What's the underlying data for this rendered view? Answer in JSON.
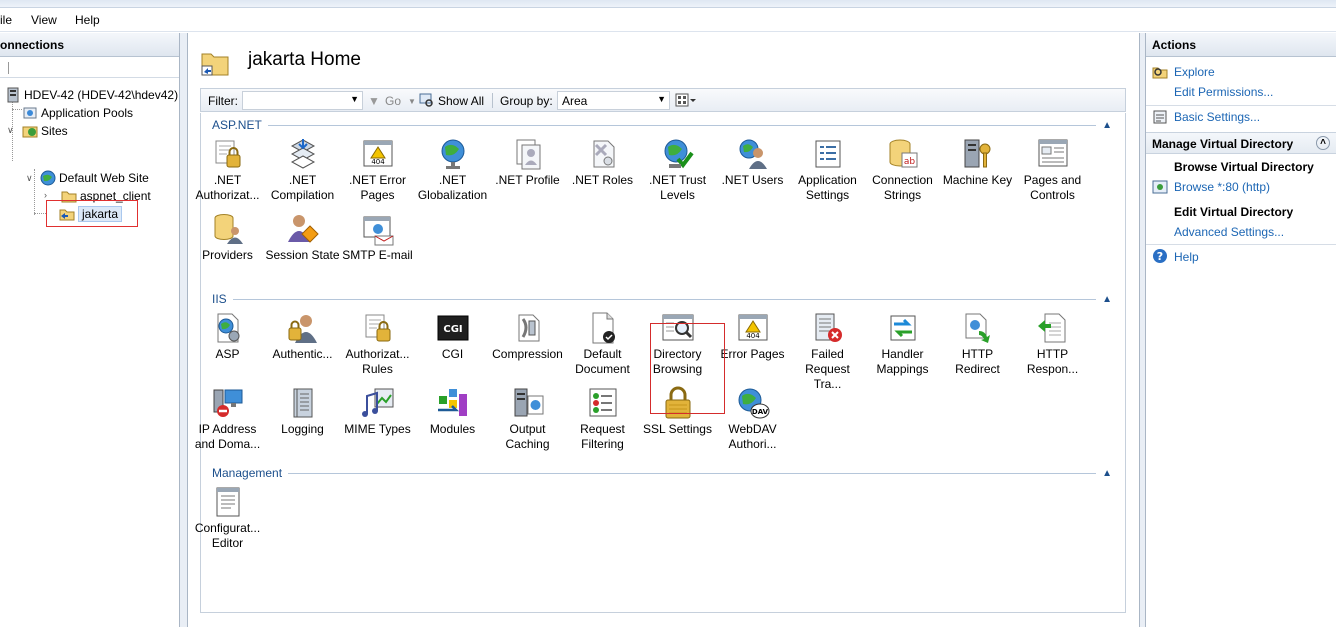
{
  "menu": {
    "file": "ile",
    "view": "View",
    "help": "Help"
  },
  "connections": {
    "title": "onnections",
    "tree": {
      "server": "HDEV-42 (HDEV-42\\hdev42)",
      "app_pools": "Application Pools",
      "sites": "Sites",
      "default_site": "Default Web Site",
      "aspnet_client": "aspnet_client",
      "jakarta": "jakarta"
    }
  },
  "center": {
    "title": "jakarta Home",
    "filter_label": "Filter:",
    "go_label": "Go",
    "show_all_label": "Show All",
    "group_by_label": "Group by:",
    "group_by_value": "Area",
    "groups": {
      "aspnet": "ASP.NET",
      "iis": "IIS",
      "management": "Management"
    },
    "aspnet_features": [
      {
        "l1": ".NET",
        "l2": "Authorizat..."
      },
      {
        "l1": ".NET",
        "l2": "Compilation"
      },
      {
        "l1": ".NET Error",
        "l2": "Pages"
      },
      {
        "l1": ".NET",
        "l2": "Globalization"
      },
      {
        "l1": ".NET Profile",
        "l2": ""
      },
      {
        "l1": ".NET Roles",
        "l2": ""
      },
      {
        "l1": ".NET Trust",
        "l2": "Levels"
      },
      {
        "l1": ".NET Users",
        "l2": ""
      },
      {
        "l1": "Application",
        "l2": "Settings"
      },
      {
        "l1": "Connection",
        "l2": "Strings"
      },
      {
        "l1": "Machine Key",
        "l2": ""
      },
      {
        "l1": "Pages and",
        "l2": "Controls"
      },
      {
        "l1": "Providers",
        "l2": ""
      },
      {
        "l1": "Session State",
        "l2": ""
      },
      {
        "l1": "SMTP E-mail",
        "l2": ""
      }
    ],
    "iis_features": [
      {
        "l1": "ASP",
        "l2": ""
      },
      {
        "l1": "Authentic...",
        "l2": ""
      },
      {
        "l1": "Authorizat...",
        "l2": "Rules"
      },
      {
        "l1": "CGI",
        "l2": ""
      },
      {
        "l1": "Compression",
        "l2": ""
      },
      {
        "l1": "Default",
        "l2": "Document"
      },
      {
        "l1": "Directory",
        "l2": "Browsing"
      },
      {
        "l1": "Error Pages",
        "l2": ""
      },
      {
        "l1": "Failed",
        "l2": "Request Tra..."
      },
      {
        "l1": "Handler",
        "l2": "Mappings"
      },
      {
        "l1": "HTTP",
        "l2": "Redirect"
      },
      {
        "l1": "HTTP",
        "l2": "Respon..."
      },
      {
        "l1": "IP Address",
        "l2": "and Doma..."
      },
      {
        "l1": "Logging",
        "l2": ""
      },
      {
        "l1": "MIME Types",
        "l2": ""
      },
      {
        "l1": "Modules",
        "l2": ""
      },
      {
        "l1": "Output",
        "l2": "Caching"
      },
      {
        "l1": "Request",
        "l2": "Filtering"
      },
      {
        "l1": "SSL Settings",
        "l2": ""
      },
      {
        "l1": "WebDAV",
        "l2": "Authori..."
      }
    ],
    "mgmt_features": [
      {
        "l1": "Configurat...",
        "l2": "Editor"
      }
    ],
    "cgi_icon_text": "CGI",
    "error_icon_text": "404",
    "webdav_icon_text": "DAV"
  },
  "actions": {
    "title": "Actions",
    "explore": "Explore",
    "edit_permissions": "Edit Permissions...",
    "basic_settings": "Basic Settings...",
    "manage_vdir": "Manage Virtual Directory",
    "browse_vdir": "Browse Virtual Directory",
    "browse_80": "Browse *:80 (http)",
    "edit_vdir": "Edit Virtual Directory",
    "advanced_settings": "Advanced Settings...",
    "help": "Help"
  },
  "colors": {
    "accent": "#1c66b4",
    "highlight_box": "#d42c2c",
    "group_title": "#1c4f8c"
  }
}
